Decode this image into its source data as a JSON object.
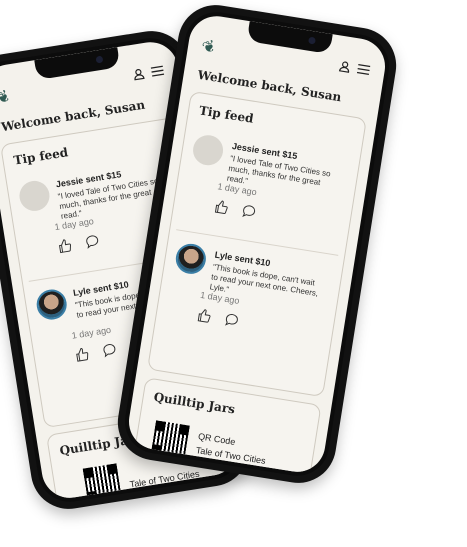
{
  "welcome": "Welcome back, Susan",
  "tip_feed": {
    "title": "Tip feed",
    "tips": [
      {
        "sender": "Jessie sent $15",
        "message": "\"I loved Tale of Two Cities so much, thanks for the great read.\"",
        "time": "1 day ago"
      },
      {
        "sender": "Lyle sent $10",
        "message": "\"This book is dope, can't wait to read your next one. Cheers, Lyle.\"",
        "time": "1 day ago"
      }
    ]
  },
  "back_phone": {
    "tips": [
      {
        "sender": "Jessie sent $15",
        "message": "\"I loved Tale of Two Cities so much, thanks for the great read.\"",
        "time": "1 day ago"
      },
      {
        "sender": "Lyle sent $10",
        "message": "\"This book is dope, can't wait to read your next one.\"",
        "time": "1 day ago"
      }
    ]
  },
  "jars": {
    "title": "Quilltip Jars",
    "item_label": "QR Code",
    "item_book": "Tale of Two Cities"
  },
  "colors": {
    "screen_bg": "#f4f2ec",
    "accent": "#2f5a52",
    "frame": "#121212"
  }
}
